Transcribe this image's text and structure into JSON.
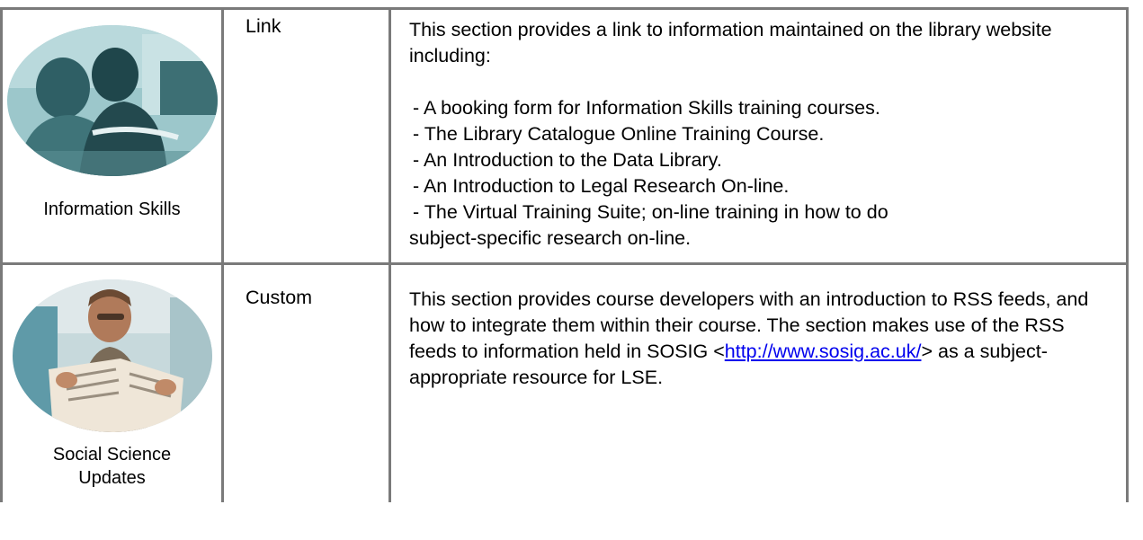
{
  "rows": [
    {
      "image_label": "Information Skills",
      "type": "Link",
      "intro": "This section provides a link to information maintained on the library website including:",
      "items": [
        "- A booking form for Information Skills training courses.",
        "- The Library Catalogue Online Training Course.",
        "- An Introduction to the Data Library.",
        "- An Introduction to Legal Research On-line.",
        "- The Virtual Training Suite; on-line training in how to do"
      ],
      "items_tail": "subject-specific research on-line."
    },
    {
      "image_label_line1": "Social Science",
      "image_label_line2": "Updates",
      "type": "Custom",
      "text_before_link": "This section provides course developers with an introduction to RSS feeds, and how to integrate them within their course. The section makes use of the RSS feeds to information held in SOSIG <",
      "link_text": "http://www.sosig.ac.uk/",
      "text_after_link": ">  as a subject-appropriate resource for LSE."
    }
  ],
  "colors": {
    "border": "#7a7a7a",
    "link": "#0000ee",
    "photo_tint": "#7fb3b8"
  }
}
